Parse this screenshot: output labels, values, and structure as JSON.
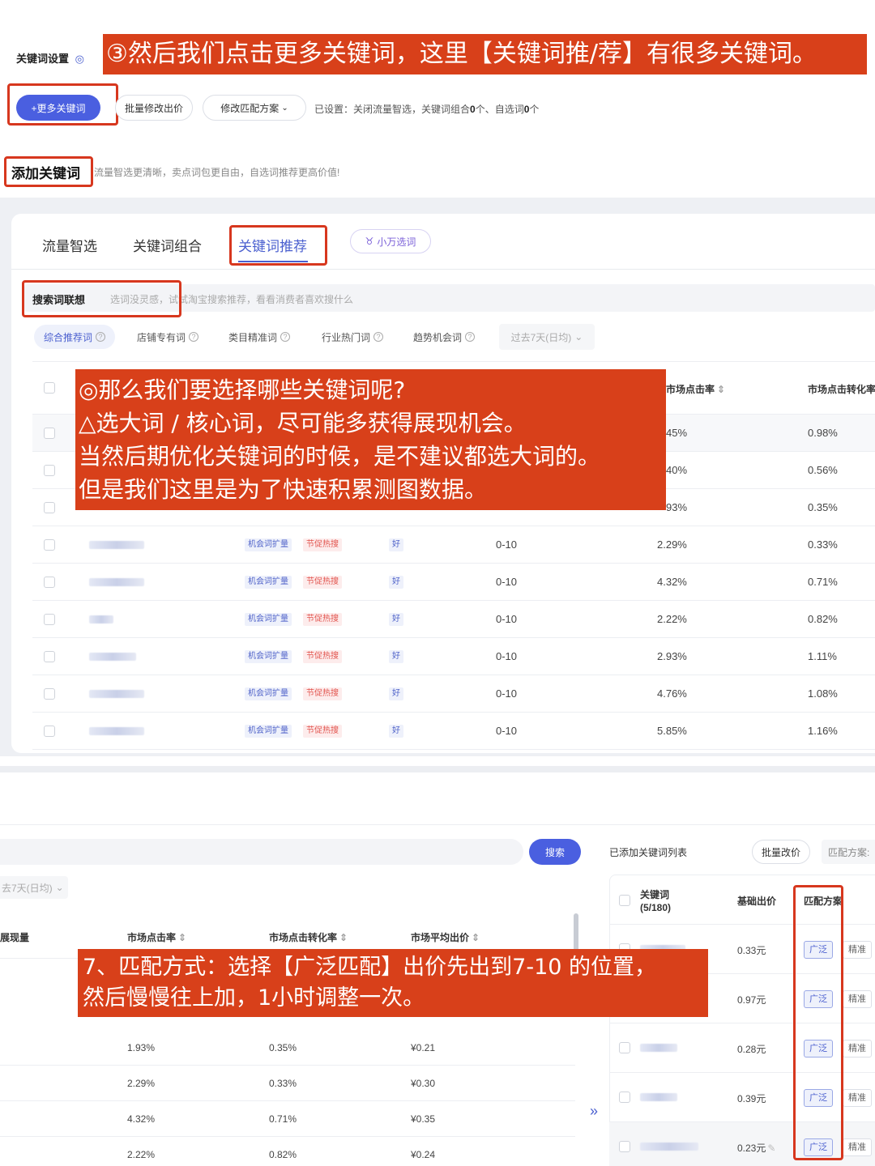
{
  "header": {
    "title": "关键词设置",
    "more_keywords_btn": "+更多关键词",
    "batch_bid_btn": "批量修改出价",
    "match_plan_btn": "修改匹配方案",
    "settings_prefix": "已设置：关闭流量智选，关键词组合",
    "settings_count1": "0",
    "settings_mid": "个、自选词",
    "settings_count2": "0",
    "settings_suffix": "个"
  },
  "add_section": {
    "title": "添加关键词",
    "desc": "流量智选更清晰，卖点词包更自由，自选词推荐更高价值!"
  },
  "tabs": [
    "流量智选",
    "关键词组合",
    "关键词推荐"
  ],
  "xiaowan": "小万选词",
  "search": {
    "label": "搜索词联想",
    "placeholder": "选词没灵感，试试淘宝搜索推荐，看看消费者喜欢搜什么"
  },
  "subtabs": [
    "综合推荐词",
    "店铺专有词",
    "类目精准词",
    "行业热门词",
    "趋势机会词"
  ],
  "period": "过去7天(日均)",
  "table_headers": {
    "ctr": "市场点击率",
    "cvr": "市场点击转化率"
  },
  "rows_top": [
    {
      "ctr": "45%",
      "cvr": "0.98%"
    },
    {
      "ctr": "40%",
      "cvr": "0.56%"
    },
    {
      "ctr": "93%",
      "cvr": "0.35%"
    }
  ],
  "rows": [
    {
      "tag1": "机会词扩量",
      "tag2": "节促热搜",
      "rating": "好",
      "rank": "0-10",
      "ctr": "2.29%",
      "cvr": "0.33%"
    },
    {
      "tag1": "机会词扩量",
      "tag2": "节促热搜",
      "rating": "好",
      "rank": "0-10",
      "ctr": "4.32%",
      "cvr": "0.71%"
    },
    {
      "tag1": "机会词扩量",
      "tag2": "节促热搜",
      "rating": "好",
      "rank": "0-10",
      "ctr": "2.22%",
      "cvr": "0.82%"
    },
    {
      "tag1": "机会词扩量",
      "tag2": "节促热搜",
      "rating": "好",
      "rank": "0-10",
      "ctr": "2.93%",
      "cvr": "1.11%"
    },
    {
      "tag1": "机会词扩量",
      "tag2": "节促热搜",
      "rating": "好",
      "rank": "0-10",
      "ctr": "4.76%",
      "cvr": "1.08%"
    },
    {
      "tag1": "机会词扩量",
      "tag2": "节促热搜",
      "rating": "好",
      "rank": "0-10",
      "ctr": "5.85%",
      "cvr": "1.16%"
    }
  ],
  "annotations": {
    "step3": "③然后我们点击更多关键词，这里【关键词推/荐】有很多关键词。",
    "choose_l1": "◎那么我们要选择哪些关键词呢?",
    "choose_l2": "△选大词 / 核心词，尽可能多获得展现机会。",
    "choose_l3": "当然后期优化关键词的时候，是不建议都选大词的。",
    "choose_l4": "但是我们这里是为了快速积累测图数据。",
    "step7_l1": "7、匹配方式：选择【广泛匹配】出价先出到7-10 的位置，",
    "step7_l2": "然后慢慢往上加，1小时调整一次。"
  },
  "bottom": {
    "search_btn": "搜索",
    "period": "去7天(日均)",
    "col_exposure": "展现量",
    "col_ctr": "市场点击率",
    "col_cvr": "市场点击转化率",
    "col_bid": "市场平均出价",
    "rows": [
      {
        "ctr": "1.93%",
        "cvr": "0.35%",
        "bid": "¥0.21"
      },
      {
        "ctr": "2.29%",
        "cvr": "0.33%",
        "bid": "¥0.30"
      },
      {
        "ctr": "4.32%",
        "cvr": "0.71%",
        "bid": "¥0.35"
      },
      {
        "ctr": "2.22%",
        "cvr": "0.82%",
        "bid": "¥0.24"
      }
    ],
    "added_list": "已添加关键词列表",
    "batch_bid": "批量改价",
    "match_plan": "匹配方案:",
    "rp_col_kw": "关键词",
    "rp_col_kw_count": "(5/180)",
    "rp_col_bid": "基础出价",
    "rp_col_match": "匹配方案",
    "rp_rows": [
      {
        "bid": "0.33元",
        "match": "广泛",
        "alt": "精准"
      },
      {
        "bid": "0.97元",
        "match": "广泛",
        "alt": "精准"
      },
      {
        "bid": "0.28元",
        "match": "广泛",
        "alt": "精准"
      },
      {
        "bid": "0.39元",
        "match": "广泛",
        "alt": "精准"
      },
      {
        "bid": "0.23元",
        "match": "广泛",
        "alt": "精准"
      }
    ]
  }
}
